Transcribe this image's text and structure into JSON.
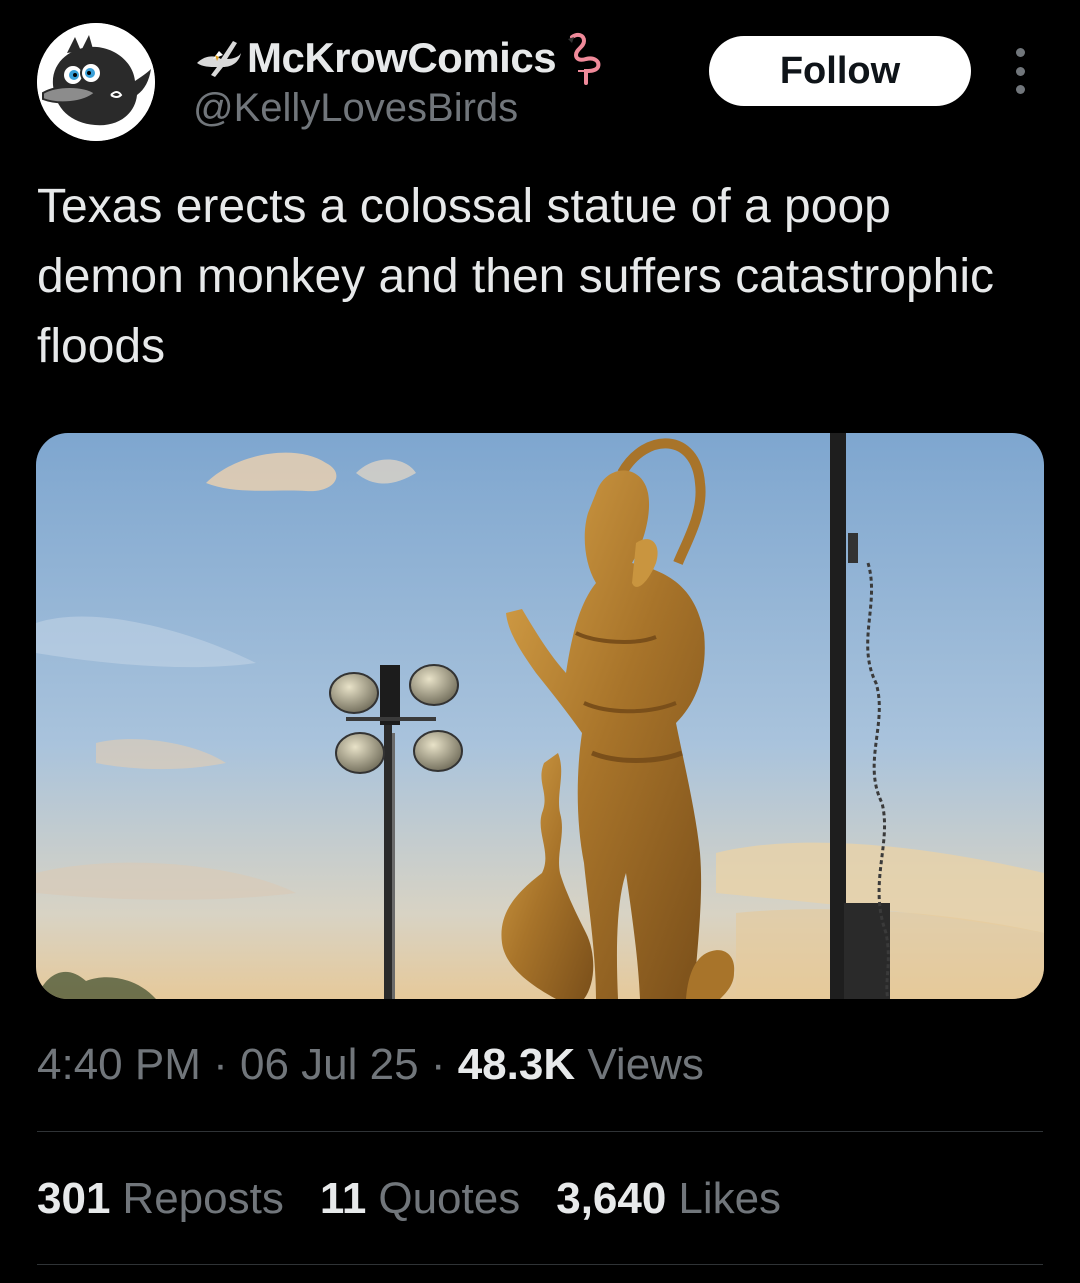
{
  "header": {
    "display_name": "McKrowComics",
    "handle": "@KellyLovesBirds",
    "follow_label": "Follow",
    "avatar_icon": "cartoon-crow-avatar",
    "name_prefix_icon": "eagle-emoji",
    "name_suffix_icon": "flamingo-emoji",
    "more_icon": "vertical-ellipsis"
  },
  "tweet": {
    "text": "Texas erects a colossal statue of a poop demon monkey and then suffers catastrophic floods"
  },
  "meta": {
    "time": "4:40 PM",
    "separator": "·",
    "date": "06 Jul 25",
    "views_count": "48.3K",
    "views_label": "Views"
  },
  "stats": {
    "reposts_count": "301",
    "reposts_label": "Reposts",
    "quotes_count": "11",
    "quotes_label": "Quotes",
    "likes_count": "3,640",
    "likes_label": "Likes"
  },
  "colors": {
    "background": "#000000",
    "text_primary": "#e7e9ea",
    "text_secondary": "#71767b",
    "divider": "#2f3336",
    "follow_bg": "#ffffff",
    "follow_text": "#0f1419"
  }
}
